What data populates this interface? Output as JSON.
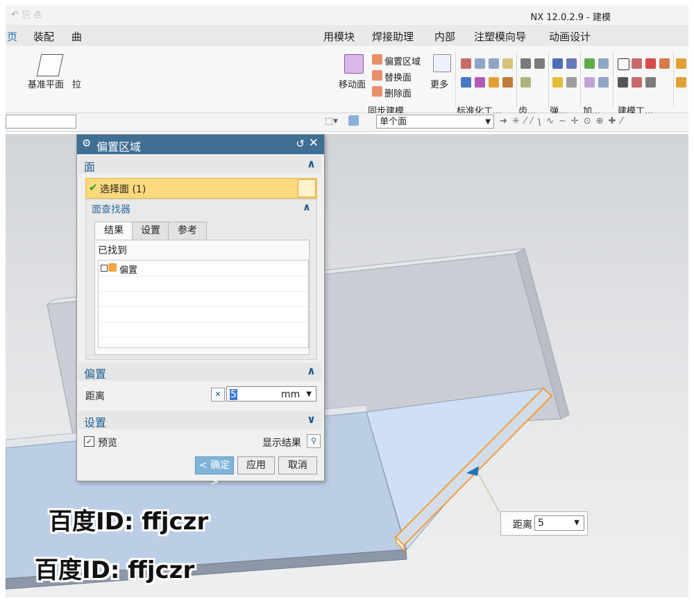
{
  "window": {
    "title": "NX 12.0.2.9 - 建模"
  },
  "menu": {
    "items": [
      "页",
      "装配",
      "用模块",
      "焊接助理",
      "内部",
      "注塑模向导",
      "动画设计"
    ],
    "truncated_item": "曲"
  },
  "ribbon": {
    "datum_plane": "基准平面",
    "truncated": "拉",
    "move_face": "移动面",
    "offset_region": "偏置区域",
    "replace_face": "替换面",
    "delete_face": "删除面",
    "more": "更多",
    "groups": {
      "sync": "同步建模",
      "standard": "标准化工...",
      "gear": "齿...",
      "spring": "弹...",
      "add": "加...",
      "modeling_tools": "建模工..."
    }
  },
  "selection_bar": {
    "face_rule": "单个面"
  },
  "dialog": {
    "title": "偏置区域",
    "face_section": "面",
    "select_face": "选择面 (1)",
    "face_finder": "面查找器",
    "tabs": [
      "结果",
      "设置",
      "参考"
    ],
    "found_label": "已找到",
    "found_items": [
      "偏置"
    ],
    "offset_section": "偏置",
    "distance_label": "距离",
    "distance_value": "5",
    "distance_unit": "mm",
    "settings_section": "设置",
    "preview_label": "预览",
    "show_result_label": "显示结果",
    "ok": "< 确定 >",
    "apply": "应用",
    "cancel": "取消"
  },
  "popup": {
    "label": "距离",
    "value": "5"
  },
  "watermarks": [
    "百度ID: ffjczr",
    "百度ID: ffjczr"
  ],
  "colors": {
    "dialog_title": "#3f6f93",
    "accent": "#1d5f93",
    "highlight": "#fbd97c",
    "edge": "#f39a35"
  }
}
